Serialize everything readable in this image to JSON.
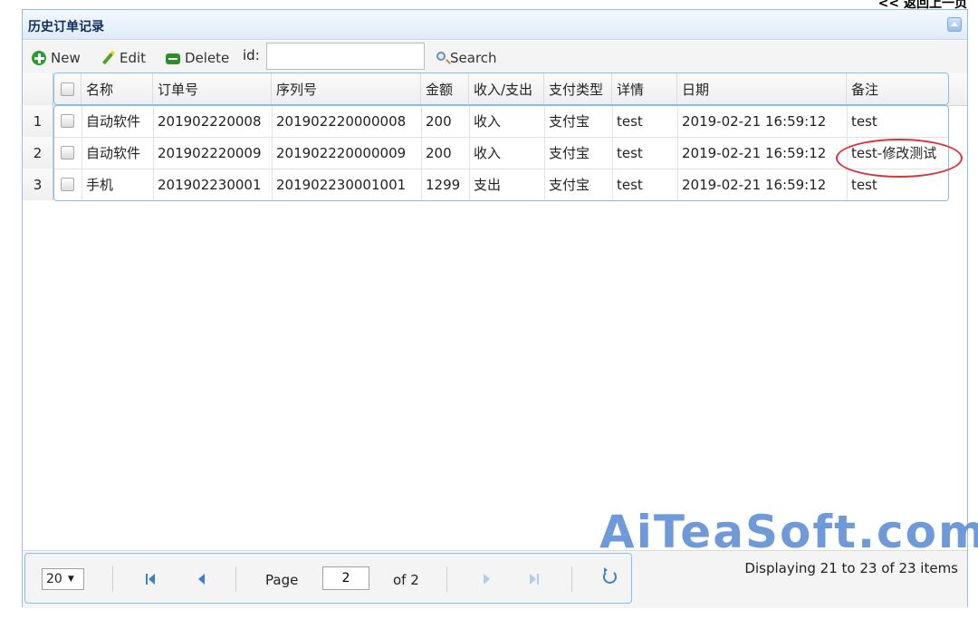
{
  "top_link": "<< 返回上一页",
  "panel": {
    "title": "历史订单记录"
  },
  "toolbar": {
    "new_label": "New",
    "edit_label": "Edit",
    "delete_label": "Delete",
    "id_label": "id:",
    "id_value": "",
    "search_label": "Search"
  },
  "columns": [
    "名称",
    "订单号",
    "序列号",
    "金额",
    "收入/支出",
    "支付类型",
    "详情",
    "日期",
    "备注"
  ],
  "rows": [
    {
      "num": "1",
      "name": "自动软件",
      "order": "201902220008",
      "serial": "201902220000008",
      "amount": "200",
      "type": "收入",
      "pay": "支付宝",
      "detail": "test",
      "date": "2019-02-21 16:59:12",
      "note": "test"
    },
    {
      "num": "2",
      "name": "自动软件",
      "order": "201902220009",
      "serial": "201902220000009",
      "amount": "200",
      "type": "收入",
      "pay": "支付宝",
      "detail": "test",
      "date": "2019-02-21 16:59:12",
      "note": "test-修改测试"
    },
    {
      "num": "3",
      "name": "手机",
      "order": "201902230001",
      "serial": "201902230001001",
      "amount": "1299",
      "type": "支出",
      "pay": "支付宝",
      "detail": "test",
      "date": "2019-02-21 16:59:12",
      "note": "test"
    }
  ],
  "pager": {
    "page_size": "20",
    "page_label": "Page",
    "page_value": "2",
    "of_label": "of 2",
    "display_info": "Displaying 21 to 23 of 23 items"
  },
  "watermark": "AiTeaSoft.com",
  "colors": {
    "header_border": "#99bbe8",
    "highlight": "#d9343a",
    "accent": "#3b7fd4"
  }
}
